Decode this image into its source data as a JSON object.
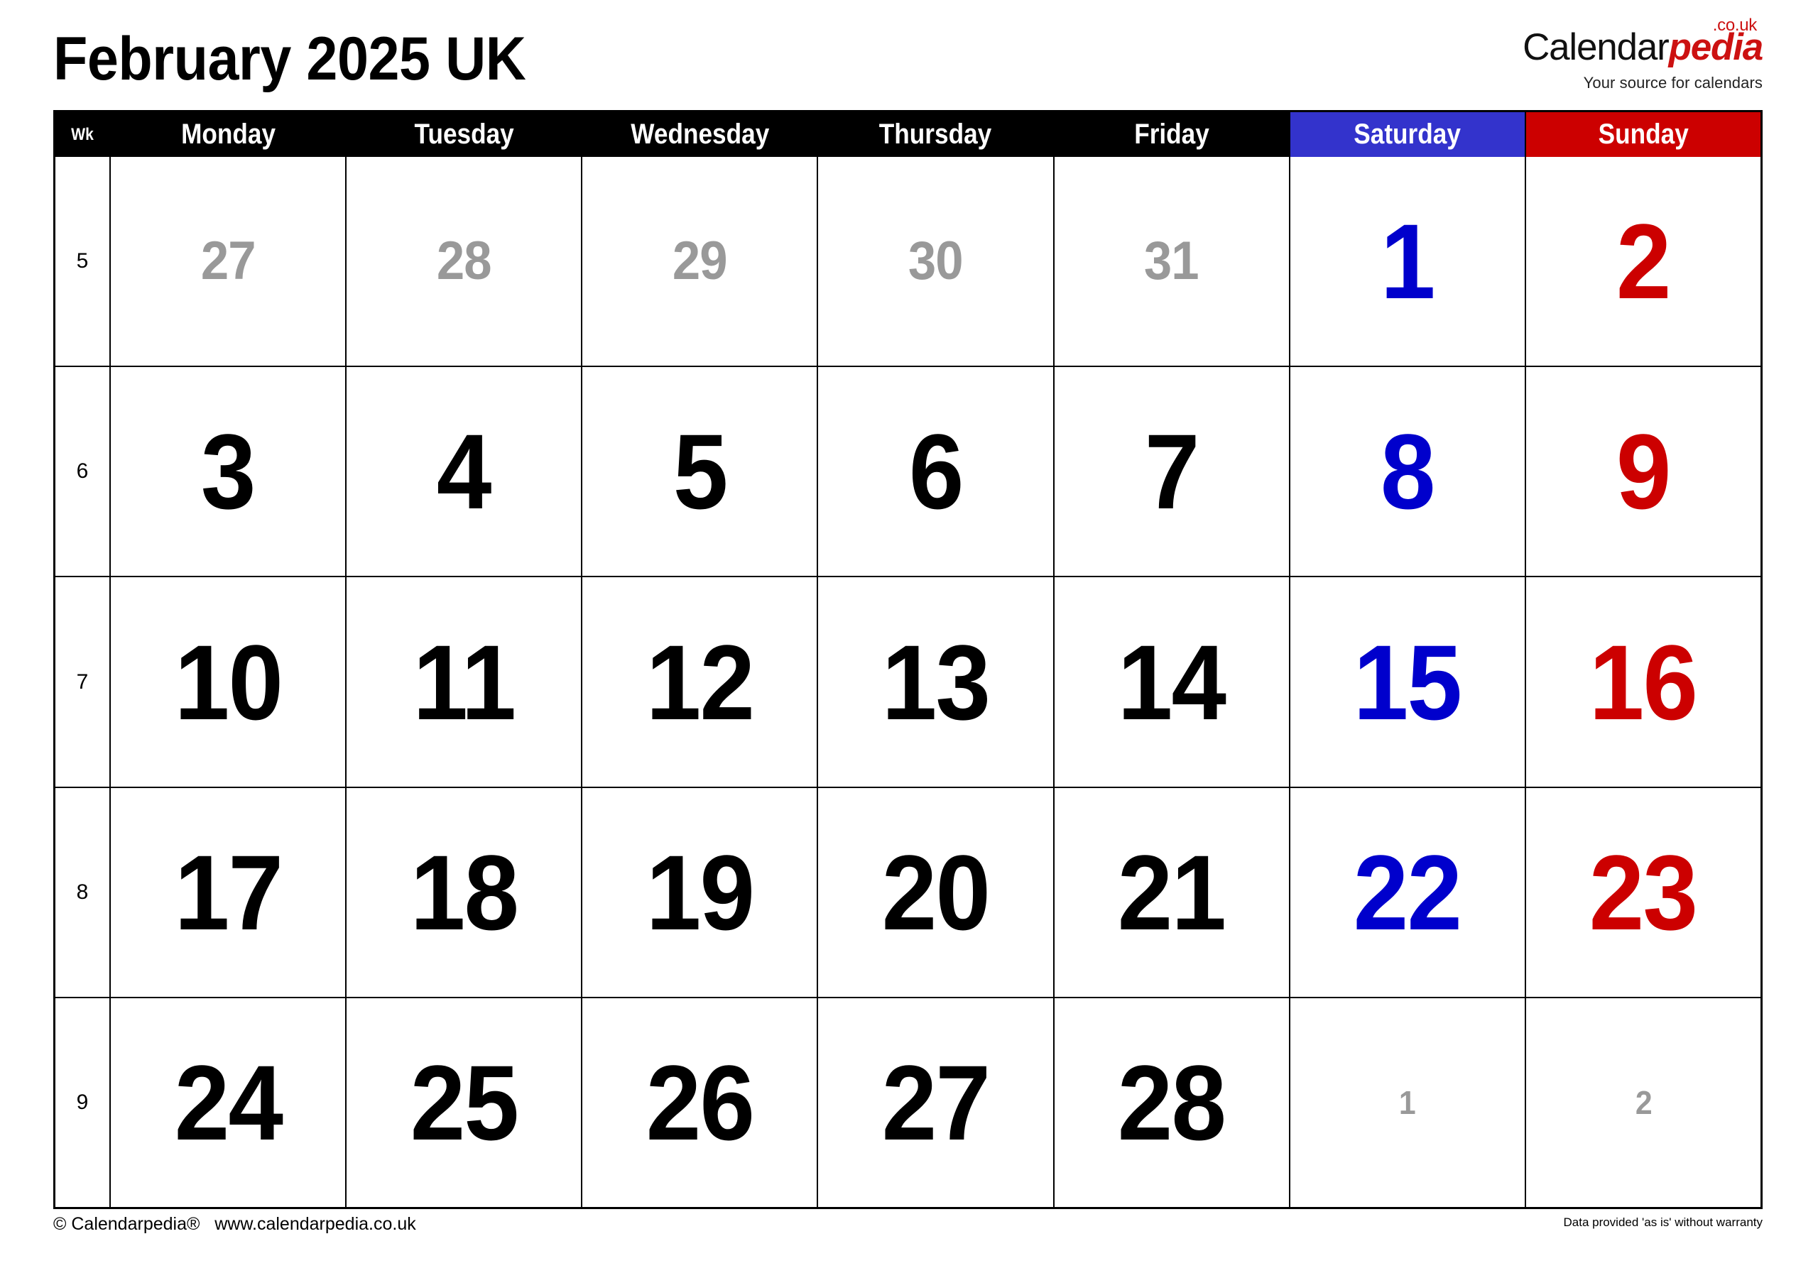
{
  "title": "February 2025 UK",
  "logo": {
    "name_part1": "Calendar",
    "name_part2": "pedia",
    "tld": ".co.uk",
    "tagline": "Your source for calendars",
    "accent_color": "#CC1111"
  },
  "colors": {
    "saturday_header_bg": "#3333CC",
    "sunday_header_bg": "#CC0000",
    "header_bg": "#000000",
    "saturday_text": "#0000CC",
    "sunday_text": "#CC0000",
    "other_month_text": "#999999",
    "current_month_text": "#000000"
  },
  "header": {
    "week_label": "Wk",
    "days": [
      "Monday",
      "Tuesday",
      "Wednesday",
      "Thursday",
      "Friday",
      "Saturday",
      "Sunday"
    ]
  },
  "weeks": [
    {
      "wk": "5",
      "days": [
        {
          "num": "27",
          "type": "prev"
        },
        {
          "num": "28",
          "type": "prev"
        },
        {
          "num": "29",
          "type": "prev"
        },
        {
          "num": "30",
          "type": "prev"
        },
        {
          "num": "31",
          "type": "prev"
        },
        {
          "num": "1",
          "type": "sat"
        },
        {
          "num": "2",
          "type": "sun"
        }
      ]
    },
    {
      "wk": "6",
      "days": [
        {
          "num": "3",
          "type": "cur"
        },
        {
          "num": "4",
          "type": "cur"
        },
        {
          "num": "5",
          "type": "cur"
        },
        {
          "num": "6",
          "type": "cur"
        },
        {
          "num": "7",
          "type": "cur"
        },
        {
          "num": "8",
          "type": "sat"
        },
        {
          "num": "9",
          "type": "sun"
        }
      ]
    },
    {
      "wk": "7",
      "days": [
        {
          "num": "10",
          "type": "cur"
        },
        {
          "num": "11",
          "type": "cur"
        },
        {
          "num": "12",
          "type": "cur"
        },
        {
          "num": "13",
          "type": "cur"
        },
        {
          "num": "14",
          "type": "cur"
        },
        {
          "num": "15",
          "type": "sat"
        },
        {
          "num": "16",
          "type": "sun"
        }
      ]
    },
    {
      "wk": "8",
      "days": [
        {
          "num": "17",
          "type": "cur"
        },
        {
          "num": "18",
          "type": "cur"
        },
        {
          "num": "19",
          "type": "cur"
        },
        {
          "num": "20",
          "type": "cur"
        },
        {
          "num": "21",
          "type": "cur"
        },
        {
          "num": "22",
          "type": "sat"
        },
        {
          "num": "23",
          "type": "sun"
        }
      ]
    },
    {
      "wk": "9",
      "days": [
        {
          "num": "24",
          "type": "cur"
        },
        {
          "num": "25",
          "type": "cur"
        },
        {
          "num": "26",
          "type": "cur"
        },
        {
          "num": "27",
          "type": "cur"
        },
        {
          "num": "28",
          "type": "cur"
        },
        {
          "num": "1",
          "type": "next"
        },
        {
          "num": "2",
          "type": "next"
        }
      ]
    }
  ],
  "footer": {
    "copyright": "© Calendarpedia®   www.calendarpedia.co.uk",
    "disclaimer": "Data provided 'as is' without warranty"
  }
}
